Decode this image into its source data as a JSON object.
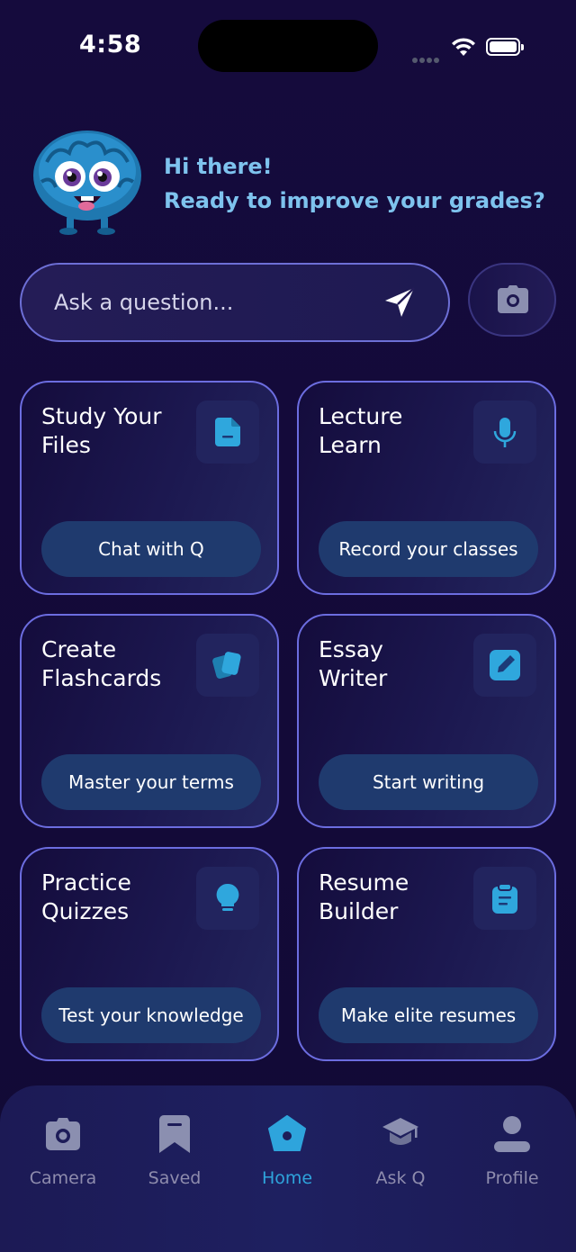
{
  "status_bar": {
    "time": "4:58"
  },
  "header": {
    "greeting_line1": "Hi there!",
    "greeting_line2": "Ready to improve your grades?"
  },
  "search": {
    "placeholder": "Ask a question..."
  },
  "cards": [
    {
      "title": "Study Your\nFiles",
      "button": "Chat with Q",
      "icon": "file-icon"
    },
    {
      "title": "Lecture\nLearn",
      "button": "Record your classes",
      "icon": "microphone-icon"
    },
    {
      "title": "Create\nFlashcards",
      "button": "Master your terms",
      "icon": "flashcards-icon"
    },
    {
      "title": "Essay\nWriter",
      "button": "Start writing",
      "icon": "pencil-icon"
    },
    {
      "title": "Practice\nQuizzes",
      "button": "Test your knowledge",
      "icon": "lightbulb-icon"
    },
    {
      "title": "Resume\nBuilder",
      "button": "Make elite resumes",
      "icon": "clipboard-icon"
    }
  ],
  "tabs": [
    {
      "label": "Camera",
      "icon": "camera-icon"
    },
    {
      "label": "Saved",
      "icon": "bookmark-icon"
    },
    {
      "label": "Home",
      "icon": "home-icon",
      "active": true
    },
    {
      "label": "Ask Q",
      "icon": "graduation-cap-icon"
    },
    {
      "label": "Profile",
      "icon": "profile-icon"
    }
  ],
  "colors": {
    "background": "#140a3a",
    "accent": "#2ea4dc",
    "greeting": "#7ec3ee",
    "card_border": "#6c6de0",
    "card_button": "#1f3a6e"
  }
}
